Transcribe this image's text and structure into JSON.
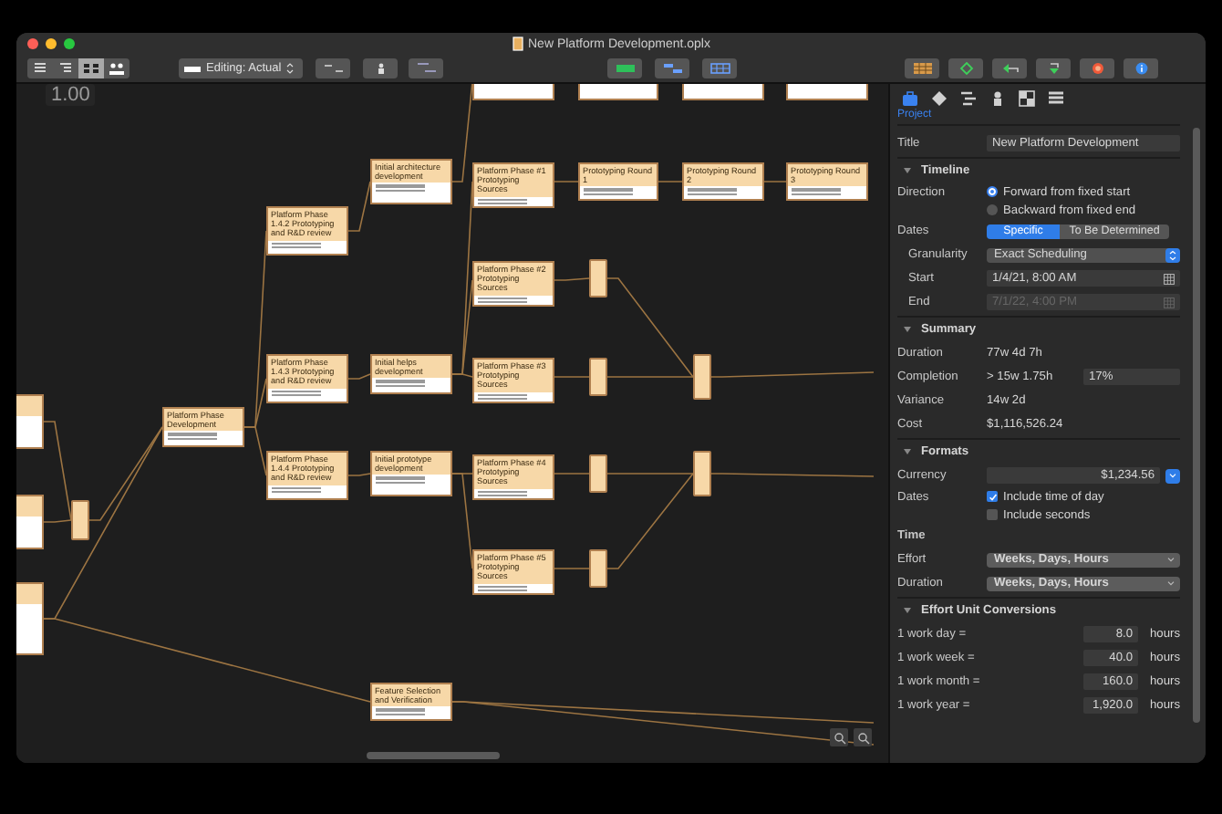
{
  "window": {
    "title": "New Platform Development.oplx"
  },
  "toolbar": {
    "zoom_label": "1.00",
    "editing_popup": "Editing: Actual",
    "view_modes": [
      {
        "selected": false
      },
      {
        "selected": false
      },
      {
        "selected": true
      },
      {
        "selected": false
      }
    ]
  },
  "network": {
    "nodes": [
      {
        "kind": "cut"
      },
      {
        "kind": "cut"
      },
      {
        "kind": "cut"
      },
      {
        "kind": "milestone"
      },
      {
        "kind": "task",
        "title": "Platform Phase Development"
      },
      {
        "kind": "task",
        "title": "Platform Phase 1.4.2 Prototyping and R&D review"
      },
      {
        "kind": "task",
        "title": "Platform Phase 1.4.3 Prototyping and R&D review"
      },
      {
        "kind": "task",
        "title": "Platform Phase 1.4.4 Prototyping and R&D review"
      },
      {
        "kind": "task",
        "title": "Initial architecture development"
      },
      {
        "kind": "task",
        "title": "Initial helps development"
      },
      {
        "kind": "task",
        "title": "Initial prototype development"
      },
      {
        "kind": "cut"
      },
      {
        "kind": "cut"
      },
      {
        "kind": "cut"
      },
      {
        "kind": "cut"
      },
      {
        "kind": "task",
        "title": "Platform Phase #1 Prototyping Sources"
      },
      {
        "kind": "task",
        "title": "Prototyping Round 1"
      },
      {
        "kind": "task",
        "title": "Prototyping Round 2"
      },
      {
        "kind": "task",
        "title": "Prototyping Round 3"
      },
      {
        "kind": "task",
        "title": "Platform Phase #2 Prototyping Sources"
      },
      {
        "kind": "milestone"
      },
      {
        "kind": "task",
        "title": "Platform Phase #3 Prototyping Sources"
      },
      {
        "kind": "milestone"
      },
      {
        "kind": "milestone"
      },
      {
        "kind": "task",
        "title": "Platform Phase #4 Prototyping Sources"
      },
      {
        "kind": "milestone"
      },
      {
        "kind": "milestone"
      },
      {
        "kind": "task",
        "title": "Platform Phase #5 Prototyping Sources"
      },
      {
        "kind": "milestone"
      },
      {
        "kind": "task",
        "title": "Feature Selection and Verification"
      }
    ]
  },
  "inspector": {
    "tabs": [
      {
        "selected": true
      },
      {
        "selected": false
      },
      {
        "selected": false
      },
      {
        "selected": false
      },
      {
        "selected": false
      },
      {
        "selected": false
      }
    ],
    "tab_label": "Project",
    "title": {
      "label": "Title",
      "value": "New Platform Development"
    },
    "sections": [
      {
        "heading": "Timeline",
        "expanded": true,
        "rows": [
          {
            "kind": "radio",
            "label": "Direction",
            "options": [
              {
                "text": "Forward from fixed start",
                "selected": true
              },
              {
                "text": "Backward from fixed end",
                "selected": false
              }
            ]
          },
          {
            "kind": "segmented",
            "label": "Dates",
            "options": [
              {
                "text": "Specific",
                "selected": true
              },
              {
                "text": "To Be Determined",
                "selected": false
              }
            ],
            "children": [
              {
                "kind": "stepper_popup",
                "label": "Granularity",
                "value": "Exact Scheduling"
              },
              {
                "kind": "date",
                "label": "Start",
                "value": "1/4/21, 8:00 AM",
                "disabled": false
              },
              {
                "kind": "date",
                "label": "End",
                "value": "7/1/22, 4:00 PM",
                "disabled": true
              }
            ]
          }
        ]
      },
      {
        "heading": "Summary",
        "expanded": true,
        "rows": [
          {
            "kind": "text",
            "label": "Duration",
            "value": "77w 4d 7h"
          },
          {
            "kind": "text_field",
            "label": "Completion",
            "value": "> 15w 1.75h",
            "field": "17%"
          },
          {
            "kind": "text",
            "label": "Variance",
            "value": "14w 2d"
          },
          {
            "kind": "text",
            "label": "Cost",
            "value": "$1,116,526.24"
          }
        ]
      },
      {
        "heading": "Formats",
        "expanded": true,
        "rows": [
          {
            "kind": "currency",
            "label": "Currency",
            "value": "$1,234.56"
          },
          {
            "kind": "checkboxes",
            "label": "Dates",
            "options": [
              {
                "text": "Include time of day",
                "checked": true
              },
              {
                "text": "Include seconds",
                "checked": false
              }
            ]
          },
          {
            "kind": "subheading",
            "label": "Time"
          },
          {
            "kind": "popup",
            "label": "Effort",
            "value": "Weeks, Days, Hours"
          },
          {
            "kind": "popup",
            "label": "Duration",
            "value": "Weeks, Days, Hours"
          }
        ]
      },
      {
        "heading": "Effort Unit Conversions",
        "expanded": true,
        "rows": [
          {
            "kind": "conversion",
            "label": "1 work day =",
            "value": "8.0",
            "unit": "hours"
          },
          {
            "kind": "conversion",
            "label": "1 work week =",
            "value": "40.0",
            "unit": "hours"
          },
          {
            "kind": "conversion",
            "label": "1 work month =",
            "value": "160.0",
            "unit": "hours"
          },
          {
            "kind": "conversion",
            "label": "1 work year =",
            "value": "1,920.0",
            "unit": "hours"
          }
        ]
      }
    ]
  }
}
